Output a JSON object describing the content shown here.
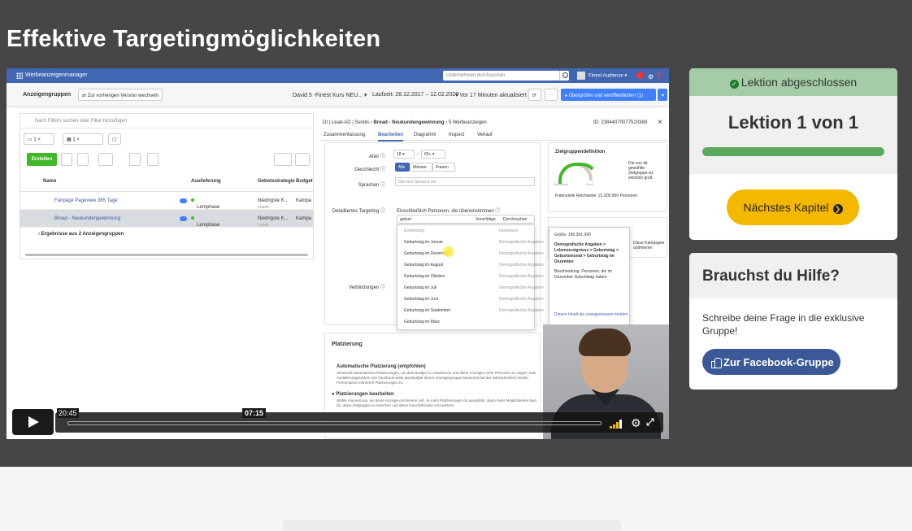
{
  "page": {
    "title": "Effektive Targetingmöglichkeiten"
  },
  "video": {
    "fb": {
      "app_name": "Werbeanzeigenmanager",
      "search_placeholder": "Unternehmen durchsuchen",
      "account": "Finest Audience",
      "section": "Anzeigengruppen",
      "switch_version": "Zur vorherigen Version wechseln",
      "campaign": "David 5 -Finest Kurs NEU...",
      "duration": "Laufzeit: 28.12.2017 – 12.02.2020",
      "updated": "Vor 17 Minuten aktualisiert",
      "publish_button": "Überprüfen und veröffentlichen (1)",
      "filter_placeholder": "Nach Filtern suchen oder Filter hinzufügen",
      "create_button": "Erstellen",
      "columns": [
        "Name",
        "Auslieferung",
        "Gebotsstrategie",
        "Budget"
      ],
      "rows": [
        {
          "name": "Fanpage Pageview 365 Tage",
          "delivery": "Lernphase",
          "bid": "Niedrigste K...",
          "bid_sub": "Leads",
          "budget": "Kampa"
        },
        {
          "name": "Broad - Neukundengewinnung",
          "delivery": "Lernphase",
          "bid": "Niedrigste K...",
          "bid_sub": "Leads",
          "budget": "Kampa"
        }
      ],
      "results_summary": "Ergebnisse aus 2 Anzeigengruppen",
      "breadcrumb": "DI | Lead-AD | Senilis",
      "breadcrumb_bold": "Broad - Neukundengewinnung",
      "breadcrumb_tail": "5 Werbeanzeigen",
      "ad_id": "ID: 23844070077520389",
      "tabs": [
        "Zusammenfassung",
        "Bearbeiten",
        "Diagramm",
        "Inspect",
        "Verlauf"
      ],
      "age_label": "Alter",
      "age_from": "18",
      "age_to": "65+",
      "gender_label": "Geschlecht",
      "gender_options": [
        "Alle",
        "Männer",
        "Frauen"
      ],
      "language_label": "Sprachen",
      "language_placeholder": "Gib eine Sprache ein ...",
      "targeting_label": "Detailliertes Targeting",
      "targeting_hint": "Einschließlich Personen, die übereinstimmen",
      "targeting_query": "geburt",
      "suggestions": "Vorschläge",
      "browse": "Durchsuchen",
      "dropdown_header": "Einbindung",
      "dropdown_header_cat": "Interessen",
      "dropdown_items": [
        "Geburtstag im Januar",
        "Geburtstag im Dezember",
        "Geburtstag im August",
        "Geburtstag im Oktober",
        "Geburtstag im Juli",
        "Geburtstag im Juni",
        "Geburtstag im September",
        "Geburtstag im März"
      ],
      "dropdown_category": "Demografische Angaben",
      "connections_label": "Verbindungen",
      "audience_title": "Zielgruppendefinition",
      "audience_text": "Die von dir gewählte Zielgruppe ist ziemlich groß.",
      "gauge_left": "Spezifisch",
      "gauge_right": "Groß",
      "reach": "Potenzielle Reichweite: 21.000.000 Personen",
      "tooltip_size": "Größe: 160.361.990",
      "tooltip_demo": "Demografische Angaben > Lebensereignisse > Geburtstag > Geburtsmonat > Geburtstag im Dezember",
      "tooltip_desc": "Beschreibung: Personen, die im Dezember Geburtstag haben",
      "tooltip_link": "Diesen Inhalt als unangemessen melden",
      "side2_text": "Diese Kampagne optimieren",
      "placement_title": "Platzierung",
      "placement_auto": "Automatische Platzierung (empfohlen)",
      "placement_auto_text": "Verwende automatische Platzierungen, um dein Budget zu maximieren und deine Anzeigen mehr Personen zu zeigen. Das Auslieferungssystem von Facebook weist das Budget deiner Anzeigengruppe basierend auf der wahrscheinlich besten Performance mehreren Platzierungen zu.",
      "placement_edit": "Platzierungen bearbeiten",
      "placement_edit_text": "Wähle manuell aus, wo deine Anzeige erscheinen soll. Je mehr Platzierungen du auswählst, desto mehr Möglichkeiten hast du, deine Zielgruppe zu erreichen und deine Geschäftsziele umzusetzen."
    },
    "controls": {
      "total_time": "20:45",
      "current_time": "07:15"
    }
  },
  "lesson_card": {
    "status": "Lektion abgeschlossen",
    "title": "Lektion 1 von 1",
    "progress_percent": 100,
    "next_button": "Nächstes Kapitel"
  },
  "help_card": {
    "title": "Brauchst du Hilfe?",
    "text": "Schreibe deine Frage in die exklusive Gruppe!",
    "button": "Zur Facebook-Gruppe"
  },
  "colors": {
    "dark_band": "#464646",
    "status_bg": "#a5cba7",
    "progress": "#5aa95c",
    "accent_yellow": "#f5b800",
    "facebook_blue": "#3b5998"
  }
}
